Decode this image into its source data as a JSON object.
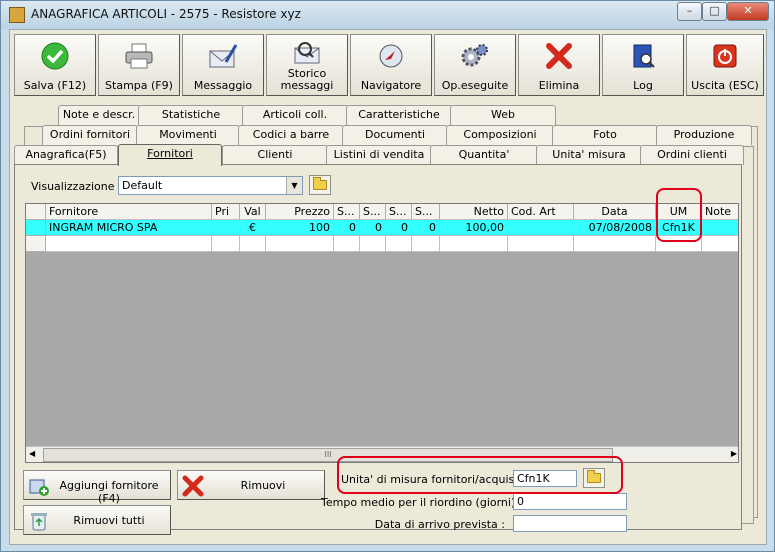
{
  "window": {
    "title": "ANAGRAFICA ARTICOLI - 2575 - Resistore xyz",
    "min_glyph": "–",
    "max_glyph": "□",
    "close_glyph": "✕"
  },
  "toolbar": {
    "save": "Salva (F12)",
    "print": "Stampa (F9)",
    "message": "Messaggio",
    "history_line1": "Storico",
    "history_line2": "messaggi",
    "navigator": "Navigatore",
    "ops_done": "Op.eseguite",
    "delete": "Elimina",
    "log": "Log",
    "exit": "Uscita (ESC)"
  },
  "tabs": {
    "row1": [
      "Note e descr.",
      "Statistiche",
      "Articoli coll.",
      "Caratteristiche",
      "Web"
    ],
    "row2": [
      "Ordini fornitori",
      "Movimenti",
      "Codici a barre",
      "Documenti",
      "Composizioni",
      "Foto",
      "Produzione"
    ],
    "row3": [
      "Anagrafica(F5)",
      "Fornitori",
      "Clienti",
      "Listini di vendita",
      "Quantita'",
      "Unita' misura",
      "Ordini clienti"
    ]
  },
  "view": {
    "label": "Visualizzazione :",
    "selected": "Default"
  },
  "grid": {
    "columns": [
      "Fornitore",
      "Pri",
      "Val",
      "Prezzo",
      "S...",
      "S...",
      "S...",
      "S...",
      "Netto",
      "Cod. Art",
      "Data",
      "UM",
      "Note"
    ],
    "rows": [
      [
        "INGRAM MICRO SPA",
        "",
        "€",
        "100",
        "0",
        "0",
        "0",
        "0",
        "100,00",
        "",
        "07/08/2008",
        "Cfn1K",
        ""
      ]
    ],
    "scroll_grip": "III"
  },
  "actions": {
    "add_supplier": "Aggiungi fornitore (F4)",
    "remove": "Rimuovi",
    "remove_all": "Rimuovi tutti"
  },
  "fields": {
    "um_label": "Unita' di misura fornitori/acquisto :",
    "um_value": "Cfn1K",
    "lead_time_label": "Tempo medio per il riordino (giorni) :",
    "lead_time_value": "0",
    "arrival_label": "Data di arrivo prevista :",
    "arrival_value": ""
  },
  "colors": {
    "selected_row": "#33ffff",
    "highlight": "#e0001a"
  }
}
